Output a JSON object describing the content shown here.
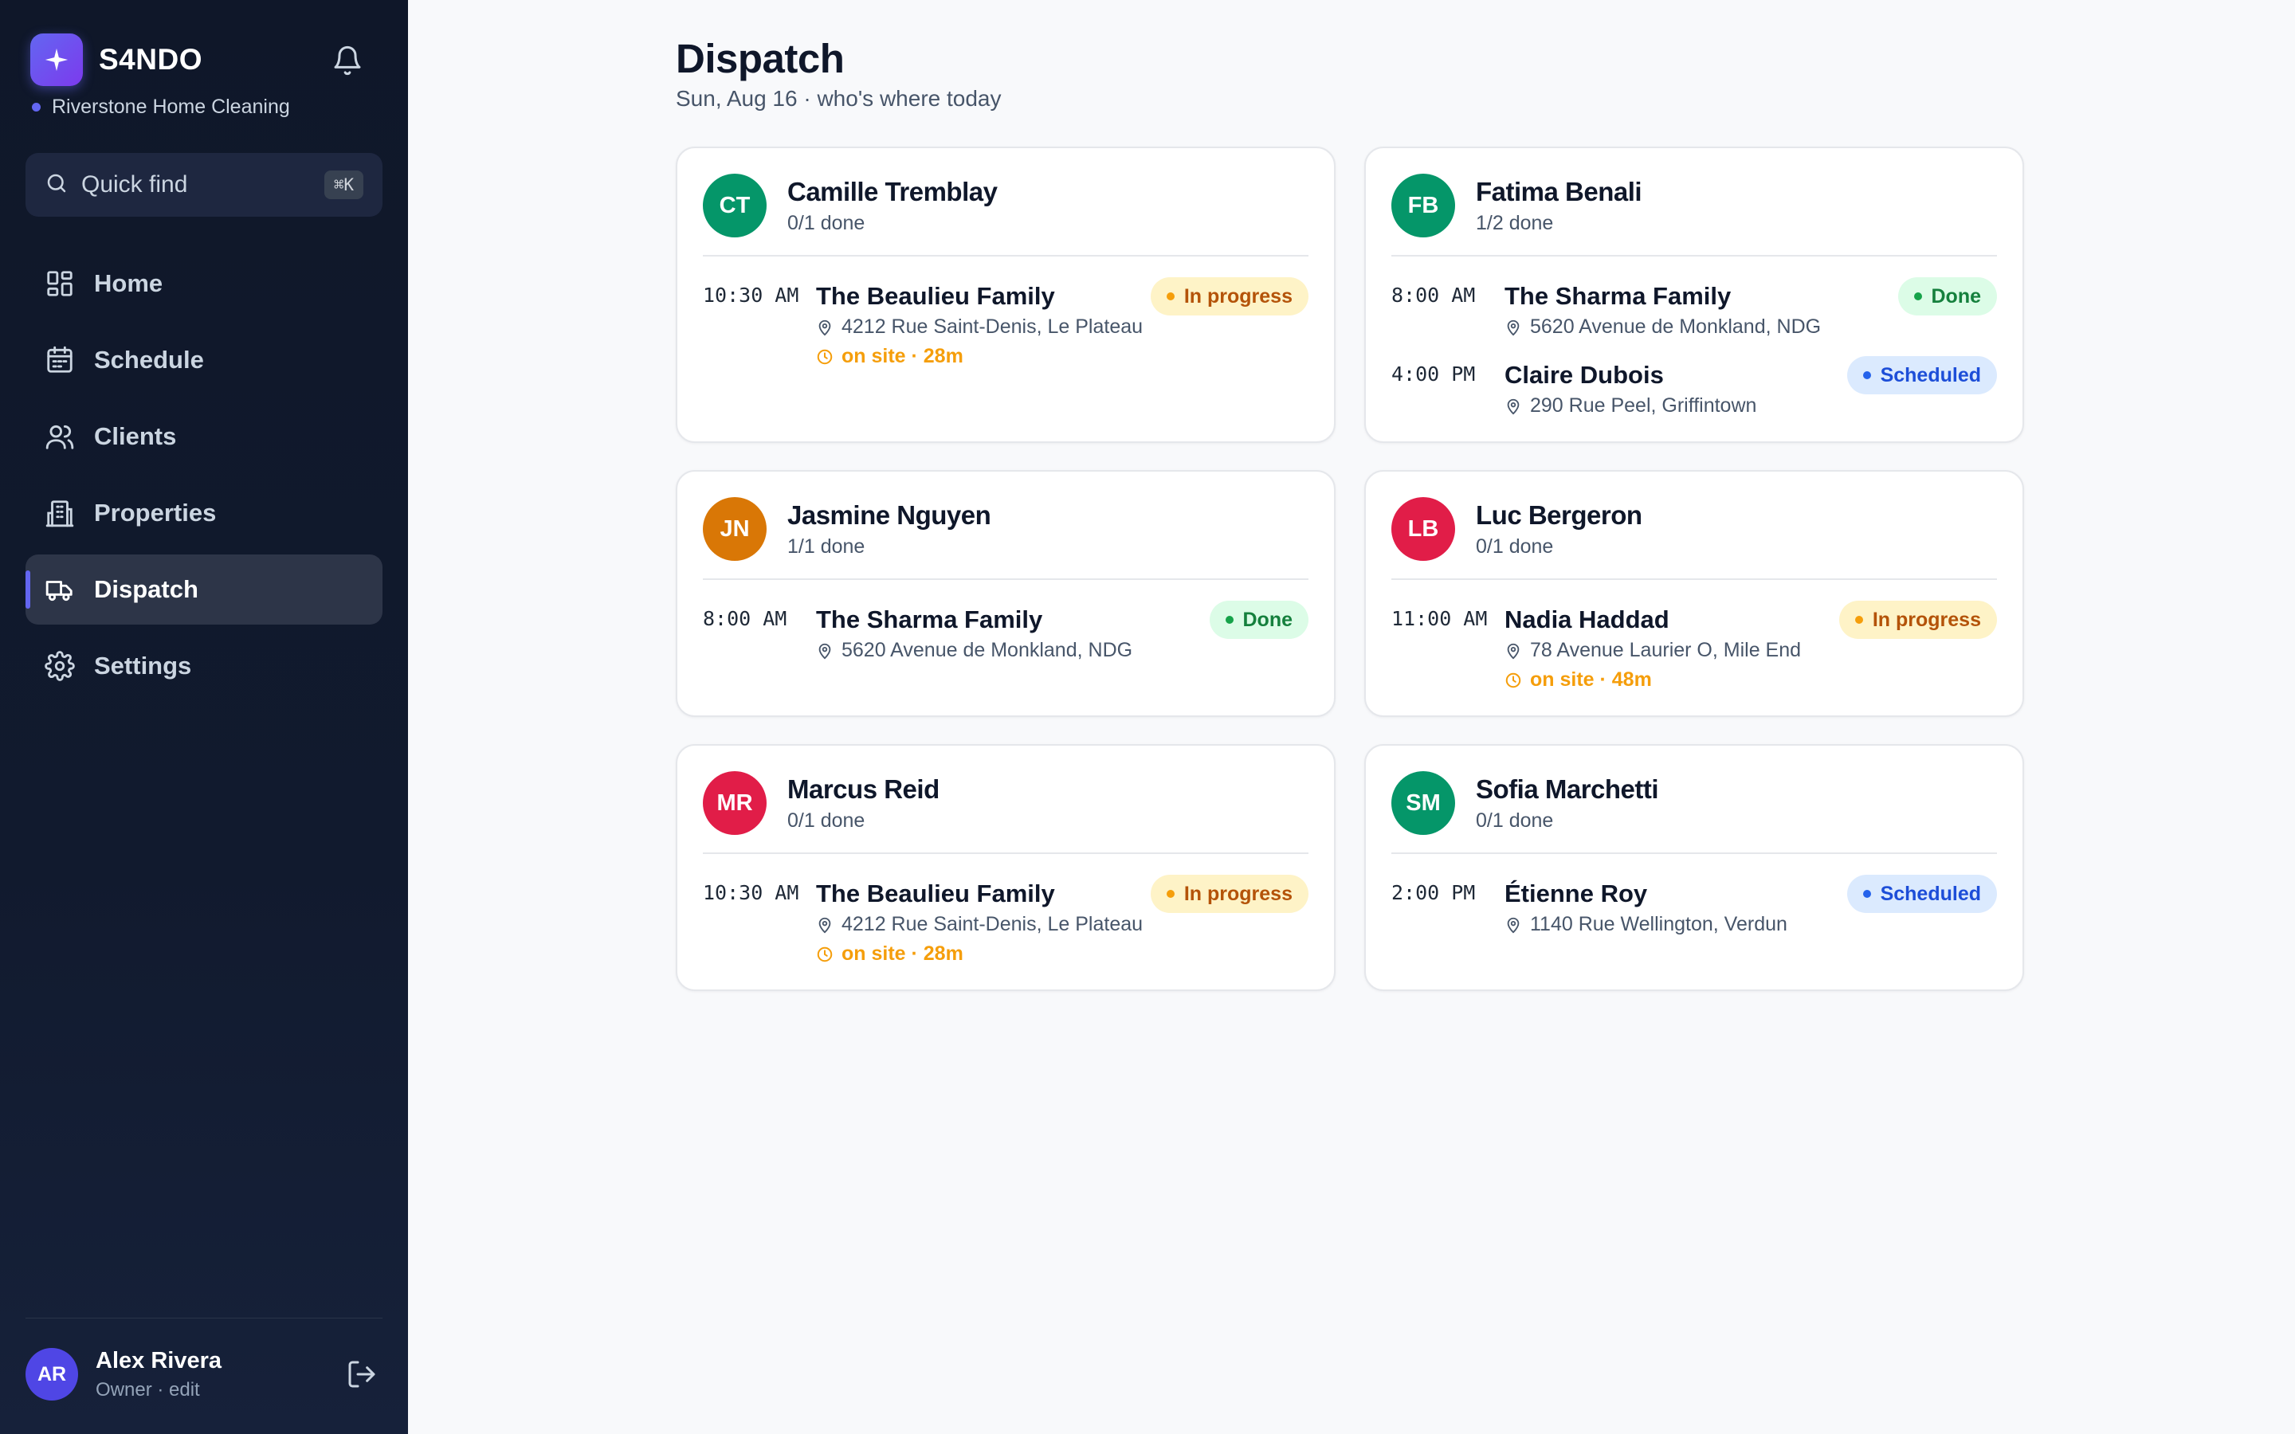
{
  "app": {
    "name": "S4NDO",
    "org": "Riverstone Home Cleaning",
    "accent": "#6366f1"
  },
  "search": {
    "label": "Quick find",
    "shortcut": "⌘K"
  },
  "nav": {
    "items": [
      {
        "label": "Home",
        "icon": "grid-icon"
      },
      {
        "label": "Schedule",
        "icon": "calendar-icon"
      },
      {
        "label": "Clients",
        "icon": "users-icon"
      },
      {
        "label": "Properties",
        "icon": "building-icon"
      },
      {
        "label": "Dispatch",
        "icon": "truck-icon",
        "active": true
      },
      {
        "label": "Settings",
        "icon": "gear-icon"
      }
    ]
  },
  "user": {
    "initials": "AR",
    "name": "Alex Rivera",
    "role": "Owner · edit"
  },
  "page": {
    "title": "Dispatch",
    "subtitle": "Sun, Aug 16 · who's where today"
  },
  "status_colors": {
    "in_progress": "#f59e0b",
    "done": "#16a34a",
    "scheduled": "#2563eb"
  },
  "cleaners": [
    {
      "initials": "CT",
      "name": "Camille Tremblay",
      "progress": "0/1 done",
      "color": "#059669",
      "jobs": [
        {
          "time": "10:30 AM",
          "client": "The Beaulieu Family",
          "address": "4212 Rue Saint-Denis, Le Plateau",
          "onsite": "on site · 28m",
          "status": "In progress",
          "status_key": "inprogress"
        }
      ]
    },
    {
      "initials": "FB",
      "name": "Fatima Benali",
      "progress": "1/2 done",
      "color": "#059669",
      "jobs": [
        {
          "time": "8:00 AM",
          "client": "The Sharma Family",
          "address": "5620 Avenue de Monkland, NDG",
          "status": "Done",
          "status_key": "done"
        },
        {
          "time": "4:00 PM",
          "client": "Claire Dubois",
          "address": "290 Rue Peel, Griffintown",
          "status": "Scheduled",
          "status_key": "scheduled"
        }
      ]
    },
    {
      "initials": "JN",
      "name": "Jasmine Nguyen",
      "progress": "1/1 done",
      "color": "#d97706",
      "jobs": [
        {
          "time": "8:00 AM",
          "client": "The Sharma Family",
          "address": "5620 Avenue de Monkland, NDG",
          "status": "Done",
          "status_key": "done"
        }
      ]
    },
    {
      "initials": "LB",
      "name": "Luc Bergeron",
      "progress": "0/1 done",
      "color": "#e11d48",
      "jobs": [
        {
          "time": "11:00 AM",
          "client": "Nadia Haddad",
          "address": "78 Avenue Laurier O, Mile End",
          "onsite": "on site · 48m",
          "status": "In progress",
          "status_key": "inprogress"
        }
      ]
    },
    {
      "initials": "MR",
      "name": "Marcus Reid",
      "progress": "0/1 done",
      "color": "#e11d48",
      "jobs": [
        {
          "time": "10:30 AM",
          "client": "The Beaulieu Family",
          "address": "4212 Rue Saint-Denis, Le Plateau",
          "onsite": "on site · 28m",
          "status": "In progress",
          "status_key": "inprogress"
        }
      ]
    },
    {
      "initials": "SM",
      "name": "Sofia Marchetti",
      "progress": "0/1 done",
      "color": "#059669",
      "jobs": [
        {
          "time": "2:00 PM",
          "client": "Étienne Roy",
          "address": "1140 Rue Wellington, Verdun",
          "status": "Scheduled",
          "status_key": "scheduled"
        }
      ]
    }
  ]
}
